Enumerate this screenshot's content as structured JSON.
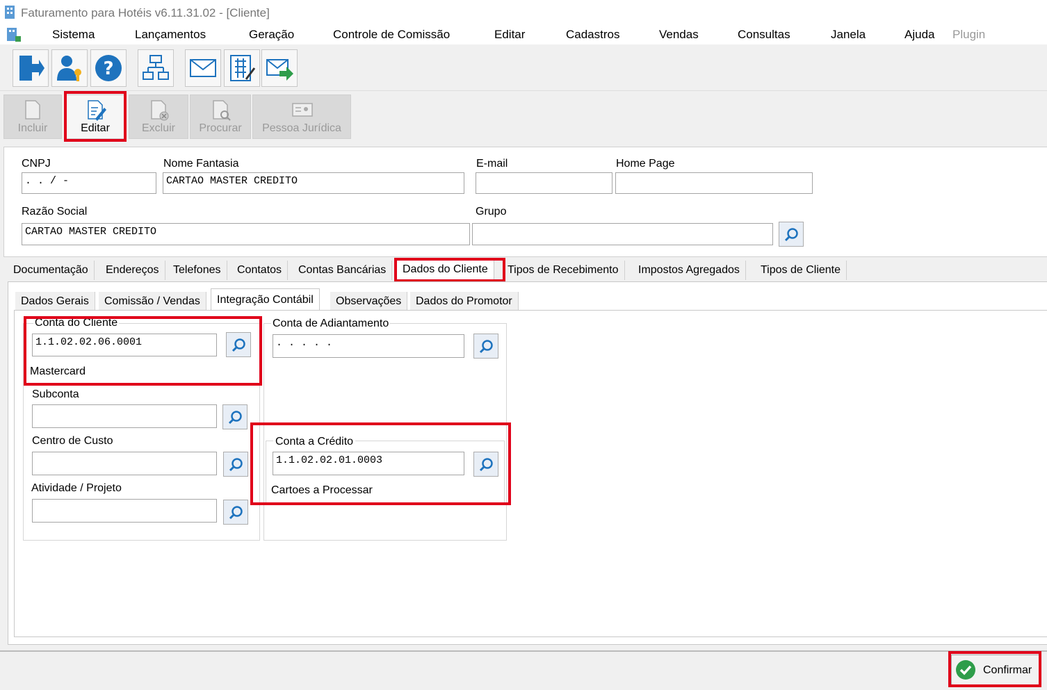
{
  "window": {
    "title": "Faturamento para Hotéis v6.11.31.02 - [Cliente]"
  },
  "menu": [
    "Sistema",
    "Lançamentos",
    "Geração",
    "Controle de Comissão",
    "Editar",
    "Cadastros",
    "Vendas",
    "Consultas",
    "Janela",
    "Ajuda",
    "Plugin"
  ],
  "toolbar": {
    "icons": [
      "exit-icon",
      "user-key-icon",
      "help-icon",
      "hierarchy-icon",
      "mail-icon",
      "calculator-icon",
      "mail-send-icon"
    ]
  },
  "actions": {
    "incluir": "Incluir",
    "editar": "Editar",
    "excluir": "Excluir",
    "procurar": "Procurar",
    "pessoa_juridica": "Pessoa Jurídica"
  },
  "form": {
    "cnpj_label": "CNPJ",
    "cnpj_value": " .  .  /    -",
    "nome_fantasia_label": "Nome Fantasia",
    "nome_fantasia_value": "CARTAO MASTER CREDITO",
    "email_label": "E-mail",
    "email_value": "",
    "home_page_label": "Home Page",
    "home_page_value": "",
    "razao_social_label": "Razão Social",
    "razao_social_value": "CARTAO MASTER CREDITO",
    "grupo_label": "Grupo",
    "grupo_value": ""
  },
  "tabs": [
    "Documentação",
    "Endereços",
    "Telefones",
    "Contatos",
    "Contas Bancárias",
    "Dados do Cliente",
    "Tipos de Recebimento",
    "Impostos Agregados",
    "Tipos de Cliente"
  ],
  "subtabs": [
    "Dados Gerais",
    "Comissão / Vendas",
    "Integração Contábil",
    "Observações",
    "Dados do Promotor"
  ],
  "integracao": {
    "conta_cliente_label": "Conta do Cliente",
    "conta_cliente_value": "1.1.02.02.06.0001",
    "conta_cliente_desc": "Mastercard",
    "subconta_label": "Subconta",
    "subconta_value": "",
    "centro_custo_label": "Centro de Custo",
    "centro_custo_value": "",
    "atividade_label": "Atividade / Projeto",
    "atividade_value": "",
    "conta_adiantamento_label": "Conta de Adiantamento",
    "conta_adiantamento_value": ". . . . .",
    "conta_credito_label": "Conta a Crédito",
    "conta_credito_value": "1.1.02.02.01.0003",
    "conta_credito_desc": "Cartoes a Processar"
  },
  "footer": {
    "confirmar": "Confirmar"
  },
  "colors": {
    "highlight": "#e0001a",
    "accent": "#1e73be",
    "confirm_green": "#2e9d4a"
  }
}
